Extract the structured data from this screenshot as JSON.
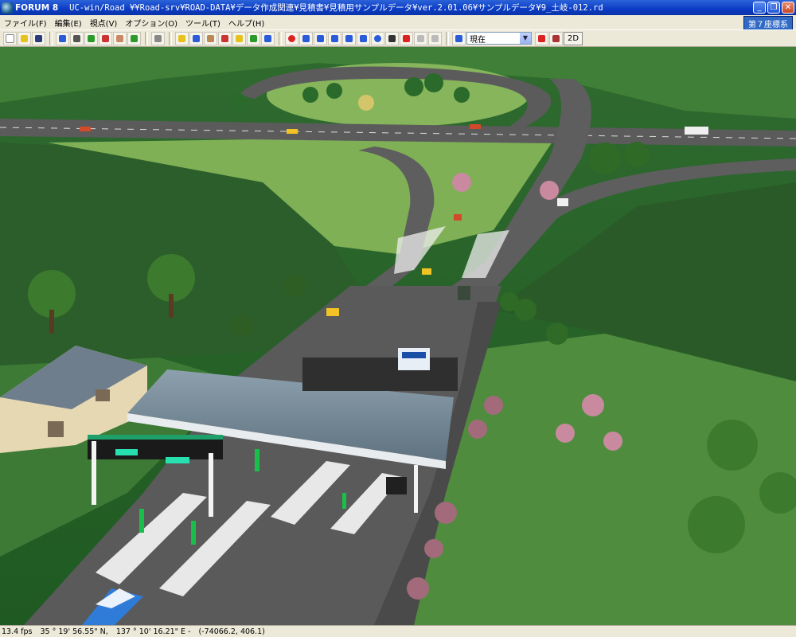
{
  "window": {
    "app_name": "FORUM 8",
    "title": "UC-win/Road  ¥¥Road-srv¥ROAD-DATA¥データ作成関連¥見積書¥見積用サンプルデータ¥ver.2.01.06¥サンプルデータ¥9_土岐-012.rd"
  },
  "menu": {
    "items": [
      "ファイル(F)",
      "編集(E)",
      "視点(V)",
      "オプション(O)",
      "ツール(T)",
      "ヘルプ(H)"
    ],
    "coord_system": "第７座標系"
  },
  "toolbar": {
    "view_mode": "現在",
    "button_2d": "2D",
    "colors": {
      "red": "#d22",
      "blue": "#2a5bd8",
      "green": "#2a9a2a",
      "yellow": "#e6c21c"
    }
  },
  "status": {
    "fps": "13.4 fps",
    "latitude": "35 °  19' 56.55\" N,",
    "longitude": "137 °  10' 16.21\" E  -",
    "position": "(-74066.2, 406.1)"
  }
}
